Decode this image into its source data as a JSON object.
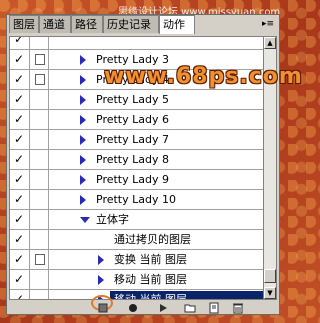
{
  "watermark": {
    "top": "思缘设计论坛 www.missyuan.com",
    "site": "www.68ps.com"
  },
  "tabs": [
    {
      "label": "图层",
      "active": false
    },
    {
      "label": "通道",
      "active": false
    },
    {
      "label": "路径",
      "active": false
    },
    {
      "label": "历史记录",
      "active": false
    },
    {
      "label": "动作",
      "active": true
    }
  ],
  "menu_icon": "panel-menu-icon",
  "rows": [
    {
      "label": "",
      "checked": true,
      "dialog": false,
      "expand": "none"
    },
    {
      "label": "Pretty Lady 3",
      "checked": true,
      "dialog": true,
      "expand": "right"
    },
    {
      "label": "Pretty Lady 4",
      "checked": true,
      "dialog": true,
      "expand": "right"
    },
    {
      "label": "Pretty Lady 5",
      "checked": true,
      "dialog": false,
      "expand": "right"
    },
    {
      "label": "Pretty Lady 6",
      "checked": true,
      "dialog": false,
      "expand": "right"
    },
    {
      "label": "Pretty Lady 7",
      "checked": true,
      "dialog": false,
      "expand": "right"
    },
    {
      "label": "Pretty Lady 8",
      "checked": true,
      "dialog": false,
      "expand": "right"
    },
    {
      "label": "Pretty Lady 9",
      "checked": true,
      "dialog": false,
      "expand": "right"
    },
    {
      "label": "Pretty Lady 10",
      "checked": true,
      "dialog": false,
      "expand": "right"
    },
    {
      "label": "立体字",
      "checked": true,
      "dialog": false,
      "expand": "down"
    },
    {
      "label": "通过拷贝的图层",
      "checked": true,
      "dialog": false,
      "expand": "none"
    },
    {
      "label": "变换 当前 图层",
      "checked": true,
      "dialog": true,
      "expand": "right"
    },
    {
      "label": "移动 当前 图层",
      "checked": true,
      "dialog": false,
      "expand": "right"
    },
    {
      "label": "移动 当前 图层",
      "checked": true,
      "dialog": false,
      "expand": "right",
      "selected": true
    }
  ],
  "toolbar": [
    {
      "name": "stop-button",
      "icon": "stop-icon"
    },
    {
      "name": "record-button",
      "icon": "record-icon"
    },
    {
      "name": "play-button",
      "icon": "play-icon"
    },
    {
      "name": "new-set-button",
      "icon": "folder-icon"
    },
    {
      "name": "new-action-button",
      "icon": "new-page-icon"
    },
    {
      "name": "delete-button",
      "icon": "trash-icon"
    }
  ],
  "colors": {
    "accent_selected": "#0a246a",
    "triangle": "#2a2ab8",
    "highlight_ring": "#e07a2a"
  }
}
